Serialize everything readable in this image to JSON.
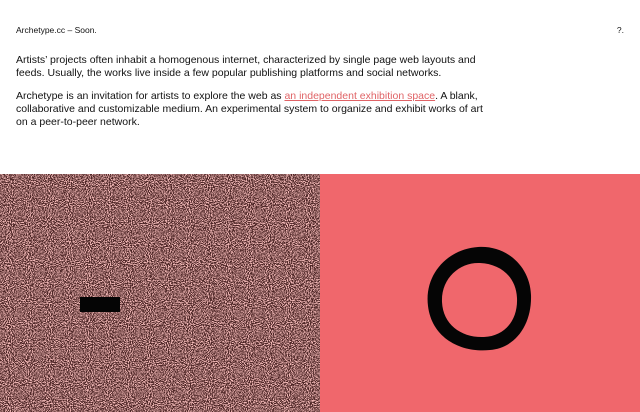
{
  "header": {
    "site_title": "Archetype.cc – Soon.",
    "help_label": "?."
  },
  "intro": {
    "paragraph_1": "Artists’ projects often inhabit a homogenous internet, characterized by single page web layouts and feeds. Usually, the works live inside a few popular publishing platforms and social networks.",
    "paragraph_2_before": "Archetype is an invitation for artists to explore the web as ",
    "paragraph_2_link": "an independent exhibition space",
    "paragraph_2_after": ". A blank, collaborative and customizable medium. An experimental system to organize and exhibit works of art on a peer-to-peer network."
  },
  "gallery": {
    "tiles": [
      {
        "name": "noise-artwork",
        "colors": {
          "base": "#5a2d2d",
          "speckle": "#e07a78",
          "shape": "#050505"
        }
      },
      {
        "name": "ring-artwork",
        "colors": {
          "background": "#f0676c",
          "shape": "#050505"
        }
      }
    ]
  },
  "colors": {
    "link": "#e06366",
    "text": "#111111",
    "background": "#ffffff"
  }
}
